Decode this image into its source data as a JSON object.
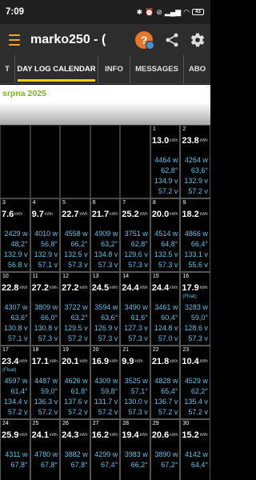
{
  "status": {
    "time": "7:09",
    "battery": "43"
  },
  "app": {
    "title": "marko250 - ("
  },
  "tabs": [
    {
      "label": "T",
      "active": false
    },
    {
      "label": "DAY LOG CALENDAR",
      "active": true
    },
    {
      "label": "INFO",
      "active": false
    },
    {
      "label": "MESSAGES",
      "active": false
    },
    {
      "label": "ABO",
      "active": false
    }
  ],
  "month": "srpna 2025",
  "kwh_unit": "kWh",
  "days": [
    {
      "empty": true
    },
    {
      "empty": true
    },
    {
      "empty": true
    },
    {
      "empty": true
    },
    {
      "empty": true
    },
    {
      "day": "1",
      "kwh": "13.0",
      "w": "4464 w",
      "pct": "62,8°",
      "v1": "134.9 v",
      "v2": "57.2 v"
    },
    {
      "day": "2",
      "kwh": "23.8",
      "w": "4264 w",
      "pct": "63,6°",
      "v1": "132.9 v",
      "v2": "57.2 v"
    },
    {
      "day": "3",
      "kwh": "7.6",
      "w": "2429 w",
      "pct": "48,2°",
      "v1": "132.9 v",
      "v2": "56.8 v"
    },
    {
      "day": "4",
      "kwh": "9.7",
      "w": "4010 w",
      "pct": "56,8°",
      "v1": "132.9 v",
      "v2": "57.1 v"
    },
    {
      "day": "5",
      "kwh": "22.7",
      "w": "4558 w",
      "pct": "66,2°",
      "v1": "132.5 v",
      "v2": "57.3 v"
    },
    {
      "day": "6",
      "kwh": "21.7",
      "w": "4909 w",
      "pct": "63,2°",
      "v1": "134.8 v",
      "v2": "57.3 v"
    },
    {
      "day": "7",
      "kwh": "25.2",
      "w": "3751 w",
      "pct": "62,8°",
      "v1": "129.6 v",
      "v2": "57.3 v"
    },
    {
      "day": "8",
      "kwh": "20.0",
      "w": "4514 w",
      "pct": "64,8°",
      "v1": "132.5 v",
      "v2": "57.3 v"
    },
    {
      "day": "9",
      "kwh": "18.2",
      "w": "4866 w",
      "pct": "66,4°",
      "v1": "133.1 v",
      "v2": "55.6 v"
    },
    {
      "day": "10",
      "kwh": "22.8",
      "w": "4307 w",
      "pct": "63,6°",
      "v1": "130.8 v",
      "v2": "57.1 v"
    },
    {
      "day": "11",
      "kwh": "27.2",
      "w": "3809 w",
      "pct": "66,0°",
      "v1": "130.8 v",
      "v2": "57.3 v"
    },
    {
      "day": "12",
      "kwh": "27.2",
      "w": "3722 w",
      "pct": "63,2°",
      "v1": "129.5 v",
      "v2": "57.2 v"
    },
    {
      "day": "13",
      "kwh": "24.5",
      "w": "3594 w",
      "pct": "63,6°",
      "v1": "126.9 v",
      "v2": "57.3 v"
    },
    {
      "day": "14",
      "kwh": "24.4",
      "w": "3490 w",
      "pct": "61,6°",
      "v1": "127.3 v",
      "v2": "57.3 v"
    },
    {
      "day": "15",
      "kwh": "24.4",
      "w": "3461 w",
      "pct": "60,4°",
      "v1": "124.8 v",
      "v2": "57.0 v"
    },
    {
      "day": "16",
      "kwh": "17.9",
      "tag": "(Float)",
      "w": "3283 w",
      "pct": "59,0°",
      "v1": "128.6 v",
      "v2": "57.3 v"
    },
    {
      "day": "17",
      "kwh": "23.4",
      "tag": "(Float)",
      "w": "4597 w",
      "pct": "61,4°",
      "v1": "134.4 v",
      "v2": "57.2 v"
    },
    {
      "day": "18",
      "kwh": "17.1",
      "w": "4487 w",
      "pct": "59,0°",
      "v1": "136.3 v",
      "v2": "57.2 v"
    },
    {
      "day": "19",
      "kwh": "20.1",
      "w": "4626 w",
      "pct": "61,8°",
      "v1": "137.6 v",
      "v2": "57.2 v"
    },
    {
      "day": "20",
      "kwh": "16.9",
      "w": "4309 w",
      "pct": "59,8°",
      "v1": "131.7 v",
      "v2": "57.2 v"
    },
    {
      "day": "21",
      "kwh": "9.9",
      "w": "3525 w",
      "pct": "57,1°",
      "v1": "130.0 v",
      "v2": "57.3 v"
    },
    {
      "day": "22",
      "kwh": "21.8",
      "w": "4828 w",
      "pct": "65,4°",
      "v1": "136.7 v",
      "v2": "57.2 v"
    },
    {
      "day": "23",
      "kwh": "10.4",
      "w": "4529 w",
      "pct": "62,2°",
      "v1": "135.4 v",
      "v2": "57.2 v"
    },
    {
      "day": "24",
      "kwh": "25.9",
      "w": "4311 w",
      "pct": "67,8°",
      "v1": "",
      "v2": ""
    },
    {
      "day": "25",
      "kwh": "24.1",
      "w": "4780 w",
      "pct": "67,8°",
      "v1": "",
      "v2": ""
    },
    {
      "day": "26",
      "kwh": "24.3",
      "w": "3882 w",
      "pct": "67,8°",
      "v1": "",
      "v2": ""
    },
    {
      "day": "27",
      "kwh": "16.2",
      "w": "4299 w",
      "pct": "67,4°",
      "v1": "",
      "v2": ""
    },
    {
      "day": "28",
      "kwh": "19.4",
      "w": "3983 w",
      "pct": "66,2°",
      "v1": "",
      "v2": ""
    },
    {
      "day": "29",
      "kwh": "20.6",
      "w": "3890 w",
      "pct": "67,2°",
      "v1": "",
      "v2": ""
    },
    {
      "day": "30",
      "kwh": "15.2",
      "w": "4142 w",
      "pct": "64,4°",
      "v1": "",
      "v2": ""
    }
  ]
}
